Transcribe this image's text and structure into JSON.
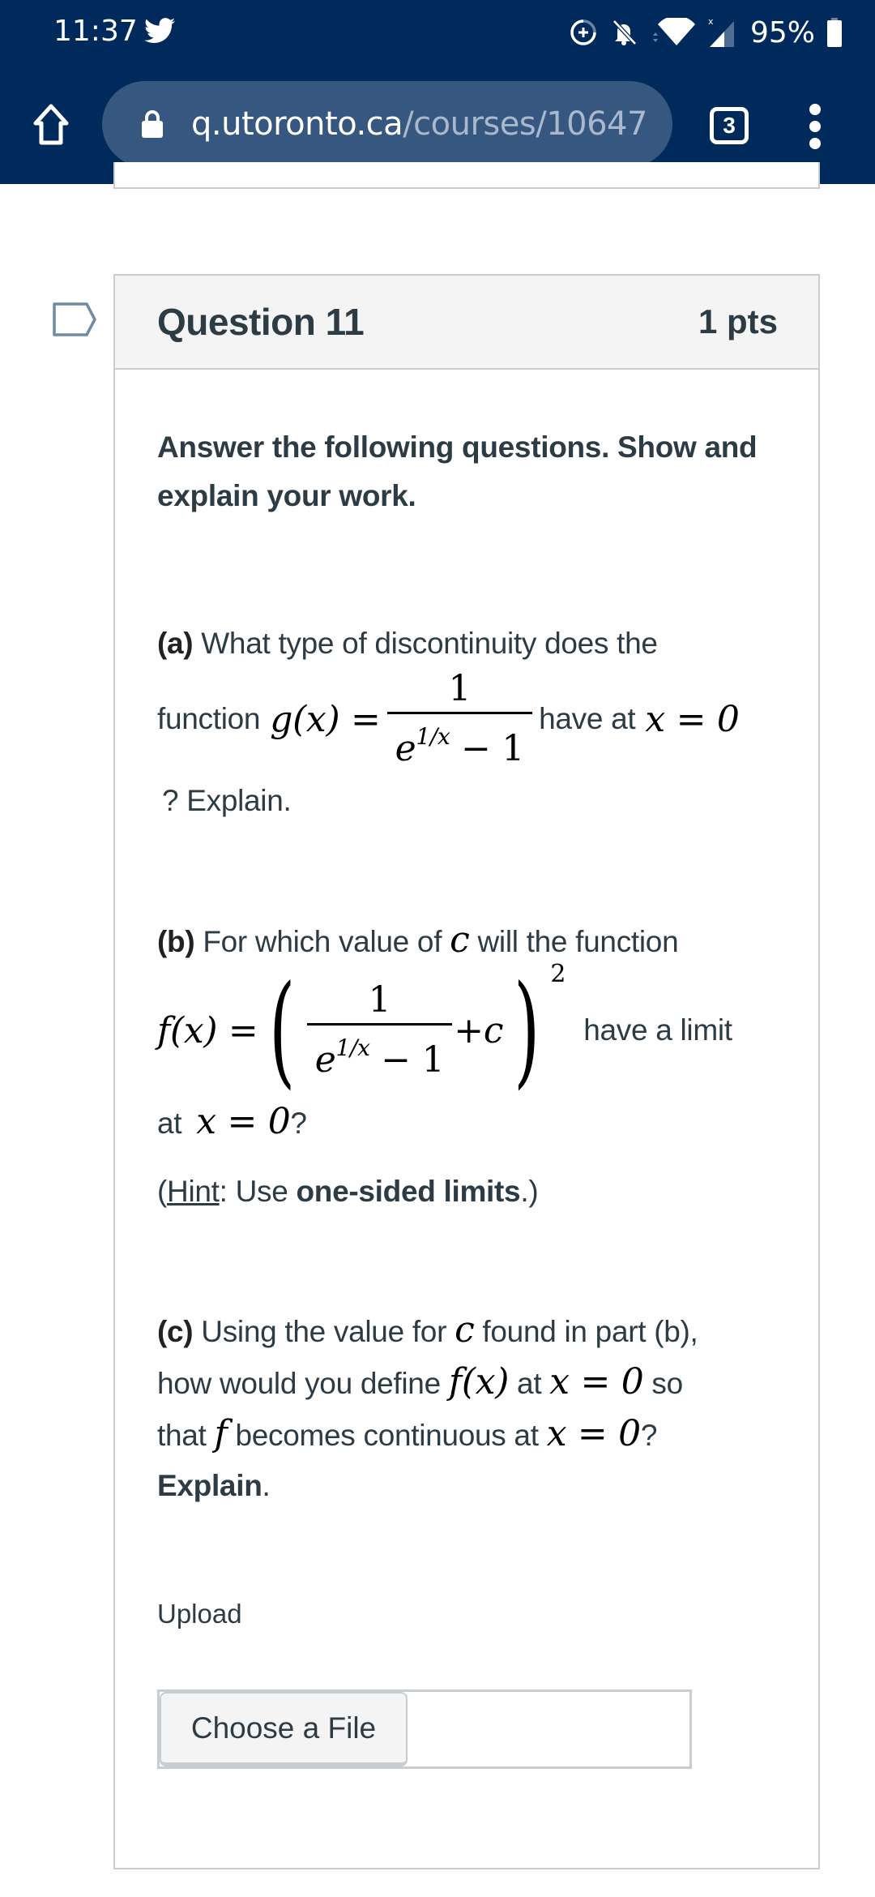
{
  "status_bar": {
    "time": "11:37",
    "battery_percent": "95%",
    "icons": [
      "twitter-icon",
      "data-saver-icon",
      "notifications-off-icon",
      "wifi-icon",
      "signal-icon",
      "battery-icon"
    ]
  },
  "browser": {
    "url_host": "q.utoronto.ca",
    "url_path": "/courses/10647",
    "tab_count": "3"
  },
  "question": {
    "title": "Question 11",
    "points": "1 pts",
    "intro": "Answer the following questions. Show and explain your work.",
    "part_a": {
      "label": "(a)",
      "text_1": " What type of discontinuity does the",
      "text_2": "function ",
      "func_name": "g(x) =",
      "numerator": "1",
      "denominator_base": "e",
      "denominator_exp": "1/x",
      "denominator_rest": " − 1",
      "text_3": " have at ",
      "point": "x = 0",
      "text_4": "? Explain."
    },
    "part_b": {
      "label": "(b)",
      "text_1": " For which value of ",
      "var_c": "c",
      "text_2": " will the function",
      "func_name": "f(x) =",
      "numerator": "1",
      "denominator_base": "e",
      "denominator_exp": "1/x",
      "denominator_rest": " − 1",
      "plus_c": "+c",
      "power": "2",
      "text_3": "have a limit",
      "text_4": "at ",
      "point": "x = 0",
      "text_5": "?",
      "hint_open": "(",
      "hint_word": "Hint",
      "hint_text": ": Use ",
      "hint_bold": "one-sided limits",
      "hint_close": ".)"
    },
    "part_c": {
      "label": "(c)",
      "text_1": " Using the value for ",
      "var_c": "c",
      "text_2": " found in part (b),",
      "text_3": "how would you define ",
      "fx": "f(x)",
      "text_4": " at ",
      "point": "x = 0",
      "text_5": " so",
      "text_6": "that ",
      "f": "f",
      "text_7": " becomes continuous at ",
      "point2": "x = 0",
      "text_8": "?",
      "explain_bold": "Explain",
      "explain_end": "."
    },
    "upload_label": "Upload",
    "choose_file_label": "Choose a File"
  }
}
